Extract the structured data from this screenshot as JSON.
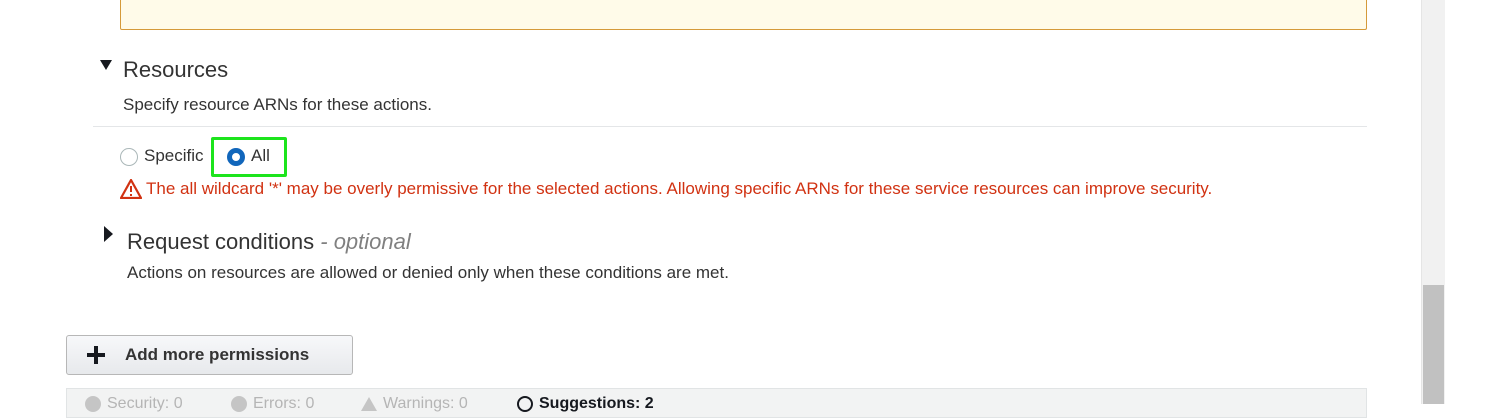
{
  "resources": {
    "title": "Resources",
    "description": "Specify resource ARNs for these actions.",
    "options": [
      {
        "label": "Specific",
        "selected": false
      },
      {
        "label": "All",
        "selected": true
      }
    ],
    "warning": "The all wildcard '*' may be overly permissive for the selected actions. Allowing specific ARNs for these service resources can improve security."
  },
  "request_conditions": {
    "title": "Request conditions",
    "optional": "- optional",
    "description": "Actions on resources are allowed or denied only when these conditions are met."
  },
  "add_permissions": {
    "label": "Add more permissions",
    "icon": "plus-icon"
  },
  "status_bar": {
    "security": "Security: 0",
    "errors": "Errors: 0",
    "warnings": "Warnings: 0",
    "suggestions": "Suggestions: 2"
  },
  "colors": {
    "accent": "#1166bb",
    "error": "#d13212",
    "highlight": "#1de41d"
  }
}
